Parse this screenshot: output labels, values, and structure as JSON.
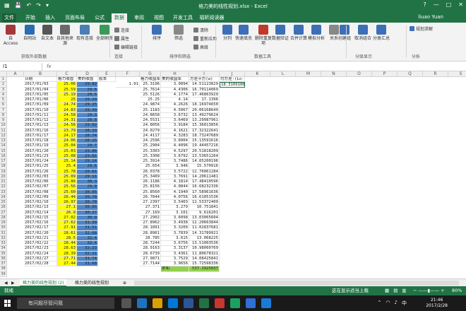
{
  "window": {
    "title": "格力美的线性规划.xlsx - Excel",
    "help": "?",
    "controls": [
      "—",
      "□",
      "✕"
    ]
  },
  "ribbon_tabs": [
    "文件",
    "开始",
    "插入",
    "页面布局",
    "公式",
    "数据",
    "审阅",
    "视图",
    "开发工具",
    "福昕阅读器"
  ],
  "active_tab_index": 5,
  "user": "liuao Yuan",
  "ribbon": {
    "big_buttons": [
      "自 Access",
      "自网站",
      "自文本",
      "自其他来源",
      "现有连接",
      "全部刷新",
      "排序",
      "筛选",
      "分列",
      "快速填充",
      "删除重复项",
      "数据验证",
      "合并计算",
      "模拟分析",
      "关系",
      "创建组",
      "取消组合",
      "分类汇总"
    ],
    "small_buttons": [
      "连接",
      "属性",
      "编辑链接",
      "清除",
      "重新应用",
      "高级"
    ],
    "groups": [
      "获取外部数据",
      "连接",
      "排序和筛选",
      "数据工具",
      "分级显示",
      "分析"
    ],
    "solver": "规划求解"
  },
  "namebox": "I1",
  "formula_icon": "fx",
  "columns": [
    "A",
    "B",
    "C",
    "D",
    "E",
    "F",
    "G",
    "H",
    "I",
    "J",
    "K",
    "L",
    "M",
    "N",
    "O",
    "P",
    "Q",
    "R",
    "S",
    "T",
    "U"
  ],
  "header": [
    "日期",
    "格力收盘",
    "美的收盘",
    "股本",
    "格力收益率",
    "美的收益率",
    "方差平方(w)",
    "均方差·(Lo·)R"
  ],
  "first_values": {
    "stake": "1.01",
    "std_res": "18.31091008"
  },
  "rows": [
    {
      "d": "2017/01/03",
      "c": "25.06",
      "e": "29.82",
      "f": "25.3196",
      "g": "3.9894",
      "h": "14.51123829"
    },
    {
      "d": "2017/01/04",
      "c": "25.59",
      "e": "29.6",
      "f": "25.7614",
      "g": "4.4306",
      "h": "16.70114069"
    },
    {
      "d": "2017/01/05",
      "c": "25.19",
      "e": "29.5",
      "f": "25.5126",
      "g": "4.1774",
      "h": "17.46863929"
    },
    {
      "d": "2017/01/06",
      "c": "25",
      "e": "29.29",
      "f": "25.25",
      "g": "4.14",
      "h": "17.1396"
    },
    {
      "d": "2017/01/09",
      "c": "24.74",
      "e": "29.25",
      "f": "24.9874",
      "g": "4.2626",
      "h": "18.16974650"
    },
    {
      "d": "2017/01/10",
      "c": "24.83",
      "e": "29.49",
      "f": "25.1183",
      "g": "4.5067",
      "h": "20.06168649"
    },
    {
      "d": "2017/01/11",
      "c": "24.58",
      "e": "29.3",
      "f": "24.8658",
      "g": "3.6732",
      "h": "13.49279624"
    },
    {
      "d": "2017/01/12",
      "c": "24.31",
      "e": "28.8",
      "f": "24.5531",
      "g": "3.6469",
      "h": "13.29987961"
    },
    {
      "d": "2017/01/13",
      "c": "24.56",
      "e": "29.02",
      "f": "24.8056",
      "g": "3.9184",
      "h": "15.36013856"
    },
    {
      "d": "2017/01/16",
      "c": "23.79",
      "e": "28.19",
      "f": "24.0279",
      "g": "4.1621",
      "h": "17.32322641"
    },
    {
      "d": "2017/01/17",
      "c": "24.17",
      "e": "28.74",
      "f": "24.4117",
      "g": "4.3283",
      "h": "18.73247689"
    },
    {
      "d": "2017/01/18",
      "c": "24.06",
      "e": "28.15",
      "f": "24.2596",
      "g": "3.8904",
      "h": "15.13591616"
    },
    {
      "d": "2017/01/19",
      "c": "25.04",
      "e": "29.7",
      "f": "25.2904",
      "g": "4.4096",
      "h": "19.44457216"
    },
    {
      "d": "2017/01/20",
      "c": "25.03",
      "e": "29.86",
      "f": "25.3303",
      "g": "4.5297",
      "h": "20.51818209"
    },
    {
      "d": "2017/01/23",
      "c": "25.08",
      "e": "29.01",
      "f": "25.3308",
      "g": "3.6792",
      "h": "13.53651264"
    },
    {
      "d": "2017/01/24",
      "c": "25.14",
      "e": "29.14",
      "f": "25.3914",
      "g": "3.7486",
      "h": "14.05200196"
    },
    {
      "d": "2017/01/25",
      "c": "25.4",
      "e": "29.6",
      "f": "25.654",
      "g": "3.946",
      "h": "15.570916"
    },
    {
      "d": "2017/01/26",
      "c": "25.78",
      "e": "29.61",
      "f": "26.0378",
      "g": "3.5722",
      "h": "12.76061284"
    },
    {
      "d": "2017/02/03",
      "c": "25.09",
      "e": "29.11",
      "f": "25.3409",
      "g": "3.7691",
      "h": "14.20611481"
    },
    {
      "d": "2017/02/06",
      "c": "25.86",
      "e": "30.3",
      "f": "26.1186",
      "g": "4.1814",
      "h": "17.48410596"
    },
    {
      "d": "2017/02/07",
      "c": "25.56",
      "e": "29.9",
      "f": "25.8156",
      "g": "4.0844",
      "h": "16.68232336"
    },
    {
      "d": "2017/02/08",
      "c": "25.60",
      "e": "30.05",
      "f": "25.8560",
      "g": "4.1940",
      "h": "17.58961636"
    },
    {
      "d": "2017/02/09",
      "c": "26.44",
      "e": "30.78",
      "f": "26.7044",
      "g": "4.0756",
      "h": "16.61051536"
    },
    {
      "d": "2017/02/10",
      "c": "26.97",
      "e": "30.78",
      "f": "27.2397",
      "g": "3.5403",
      "h": "12.53372409"
    },
    {
      "d": "2017/02/13",
      "c": "27.1",
      "e": "30.65",
      "f": "27.371",
      "g": "3.279",
      "h": "10.751841"
    },
    {
      "d": "2017/02/14",
      "c": "26.9",
      "e": "30.27",
      "f": "27.169",
      "g": "3.101",
      "h": "9.616201"
    },
    {
      "d": "2017/02/15",
      "c": "27.02",
      "e": "30.9",
      "f": "27.2902",
      "g": "3.6098",
      "h": "13.03065604"
    },
    {
      "d": "2017/02/16",
      "c": "27.62",
      "e": "31.39",
      "f": "27.8962",
      "g": "3.4938",
      "h": "12.20663844"
    },
    {
      "d": "2017/02/17",
      "c": "27.91",
      "e": "31.51",
      "f": "28.1891",
      "g": "3.3209",
      "h": "11.02837681"
    },
    {
      "d": "2017/02/20",
      "c": "28.61",
      "e": "32.68",
      "f": "28.8961",
      "g": "3.7839",
      "h": "14.31789921"
    },
    {
      "d": "2017/02/21",
      "c": "28.5",
      "e": "32.4",
      "f": "28.785",
      "g": "3.615",
      "h": "13.068225"
    },
    {
      "d": "2017/02/22",
      "c": "28.44",
      "e": "32.4",
      "f": "28.7244",
      "g": "3.6756",
      "h": "13.51003536"
    },
    {
      "d": "2017/02/23",
      "c": "28.63",
      "e": "32.23",
      "f": "28.9163",
      "g": "3.3137",
      "h": "10.98060769"
    },
    {
      "d": "2017/02/24",
      "c": "28.39",
      "e": "32.11",
      "f": "28.6739",
      "g": "3.4361",
      "h": "11.80678321"
    },
    {
      "d": "2017/02/27",
      "c": "27.71",
      "e": "31.74",
      "f": "27.9871",
      "g": "3.7529",
      "h": "14.08425841"
    },
    {
      "d": "2017/02/28",
      "c": "27.44",
      "e": "31.68",
      "f": "27.7144",
      "g": "3.9656",
      "h": "15.72598336"
    }
  ],
  "total_label": "求和",
  "total_value": "537.1925037",
  "sheets": [
    "格力美的线性规划 (2)",
    "格力美的线性规划"
  ],
  "active_sheet_index": 0,
  "status": {
    "left": "就绪",
    "warn": "这在显示适当上载",
    "zoom": "80%"
  },
  "taskbar": {
    "search": "有问题尽管问我",
    "time": "21:46",
    "date": "2017/2/28",
    "lang": "中"
  },
  "colors": {
    "excel_green": "#217346",
    "yellow_fill": "#ffff00",
    "blue_fill": "#4f86c6",
    "green_fill": "#92d050"
  }
}
